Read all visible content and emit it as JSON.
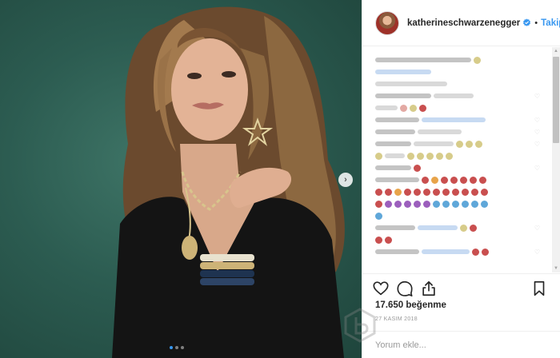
{
  "post": {
    "username": "katherineschwarzenegger",
    "verified_icon": "verified-badge-icon",
    "separator": "•",
    "follow_label": "Takip E",
    "likes": "17.650 beğenme",
    "date": "27 KASIM 2018",
    "comment_placeholder": "Yorum ekle...",
    "carousel": {
      "total": 3,
      "active": 1
    }
  },
  "icons": {
    "like": "heart-outline-icon",
    "comment": "speech-bubble-icon",
    "share": "share-arrow-icon",
    "save": "bookmark-icon",
    "next": "chevron-right-icon"
  },
  "colors": {
    "accent": "#3897f0",
    "text": "#262626",
    "muted": "#999999",
    "photo_background": "#2c5c51"
  }
}
